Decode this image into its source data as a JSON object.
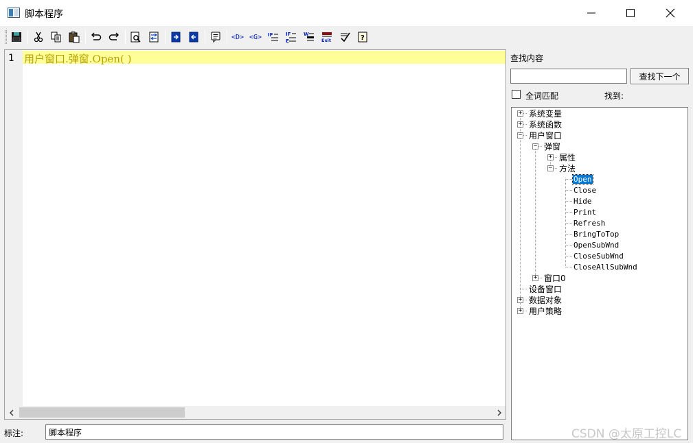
{
  "window": {
    "title": "脚本程序"
  },
  "toolbar": {
    "buttons": [
      "save-icon",
      "cut-icon",
      "copy-icon",
      "paste-icon",
      "undo-icon",
      "redo-icon",
      "find-icon",
      "replace-icon",
      "bookmark-next-icon",
      "bookmark-prev-icon",
      "comment-icon",
      "insert-d-icon",
      "insert-g-icon",
      "if-icon",
      "if-else-icon",
      "while-icon",
      "exit-icon",
      "check-icon",
      "help-icon"
    ],
    "labels": {
      "d": "<D>",
      "g": "<G>",
      "exit": "Exit"
    }
  },
  "editor": {
    "lines": [
      {
        "number": "1",
        "code": "用户窗口.弹窗.Open( )"
      }
    ]
  },
  "status": {
    "label": "标注:",
    "value": "脚本程序"
  },
  "search": {
    "label": "查找内容",
    "value": "",
    "find_next": "查找下一个",
    "whole_word": "全词匹配",
    "found": "找到:"
  },
  "tree": {
    "system_vars": "系统变量",
    "system_funcs": "系统函数",
    "user_windows": "用户窗口",
    "popup": "弹窗",
    "properties": "属性",
    "methods": "方法",
    "method_items": [
      "Open",
      "Close",
      "Hide",
      "Print",
      "Refresh",
      "BringToTop",
      "OpenSubWnd",
      "CloseSubWnd",
      "CloseAllSubWnd"
    ],
    "window0": "窗口0",
    "device_windows": "设备窗口",
    "data_objects": "数据对象",
    "user_strategy": "用户策略"
  },
  "watermark": "CSDN @太原工控LC"
}
